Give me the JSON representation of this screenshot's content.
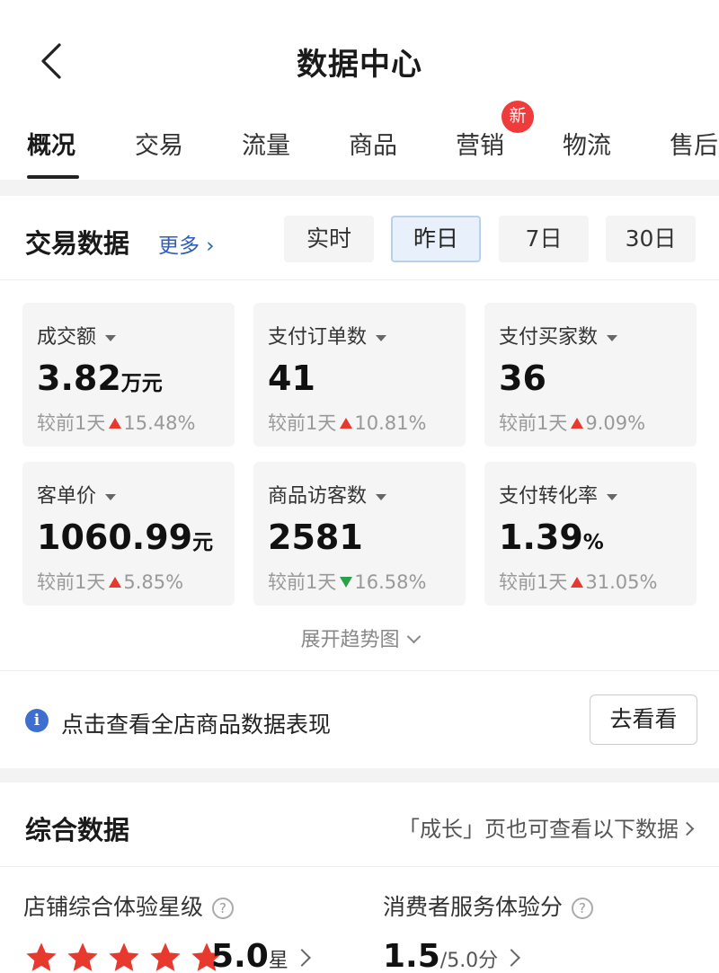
{
  "header": {
    "title": "数据中心"
  },
  "tabs": [
    {
      "label": "概况"
    },
    {
      "label": "交易"
    },
    {
      "label": "流量"
    },
    {
      "label": "商品"
    },
    {
      "label": "营销",
      "badge": "新"
    },
    {
      "label": "物流"
    },
    {
      "label": "售后"
    }
  ],
  "trade": {
    "title": "交易数据",
    "more": "更多 ›",
    "ranges": [
      "实时",
      "昨日",
      "7日",
      "30日"
    ],
    "selected_range": "昨日",
    "cards": [
      {
        "label": "成交额",
        "value": "3.82",
        "unit": "万元",
        "cmp_prefix": "较前1天",
        "direction": "up",
        "change": "15.48%"
      },
      {
        "label": "支付订单数",
        "value": "41",
        "unit": "",
        "cmp_prefix": "较前1天",
        "direction": "up",
        "change": "10.81%"
      },
      {
        "label": "支付买家数",
        "value": "36",
        "unit": "",
        "cmp_prefix": "较前1天",
        "direction": "up",
        "change": "9.09%"
      },
      {
        "label": "客单价",
        "value": "1060.99",
        "unit": "元",
        "cmp_prefix": "较前1天",
        "direction": "up",
        "change": "5.85%"
      },
      {
        "label": "商品访客数",
        "value": "2581",
        "unit": "",
        "cmp_prefix": "较前1天",
        "direction": "down",
        "change": "16.58%"
      },
      {
        "label": "支付转化率",
        "value": "1.39",
        "unit": "%",
        "cmp_prefix": "较前1天",
        "direction": "up",
        "change": "31.05%"
      }
    ],
    "expand": "展开趋势图"
  },
  "info": {
    "text": "点击查看全店商品数据表现",
    "button": "去看看"
  },
  "composite": {
    "title": "综合数据",
    "note": "「成长」页也可查看以下数据",
    "metrics": [
      {
        "label": "店铺综合体验星级",
        "value": "5.0",
        "unit": "星",
        "stars": 5
      },
      {
        "label": "消费者服务体验分",
        "value": "1.5",
        "unit": "/5.0分"
      }
    ]
  },
  "colors": {
    "up": "#e8392e",
    "down": "#2aa24a",
    "star": "#e8392e",
    "link": "#2f5fb8"
  }
}
